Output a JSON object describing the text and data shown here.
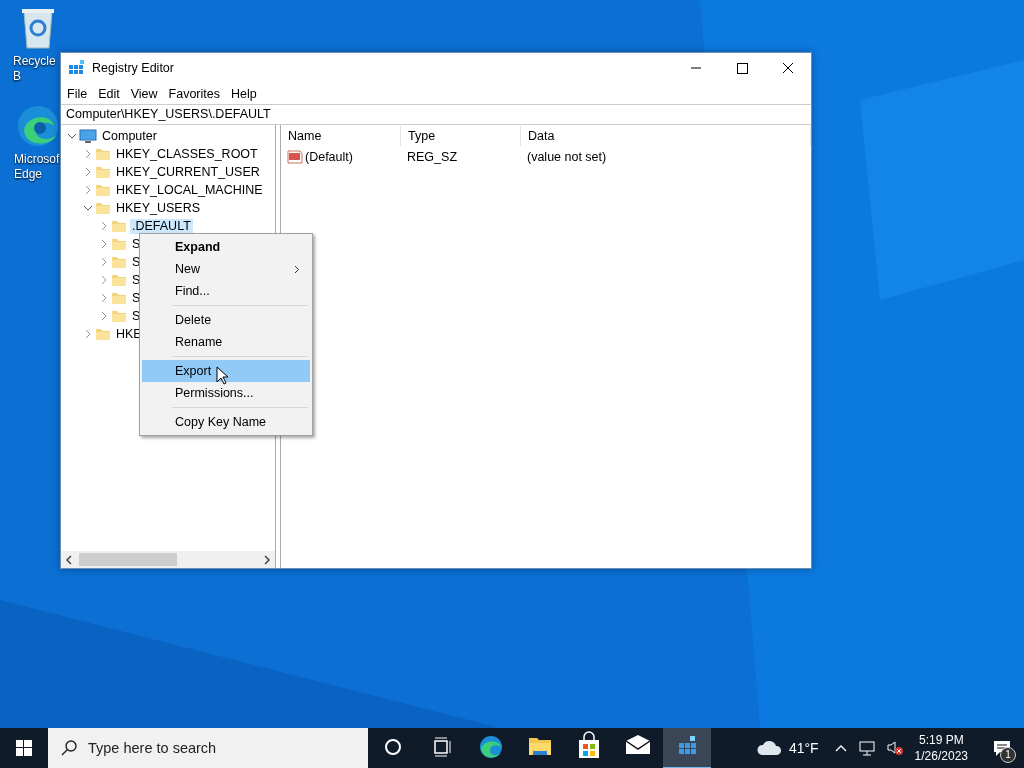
{
  "desktop_icons": [
    {
      "kind": "recycle",
      "label": "Recycle B"
    },
    {
      "kind": "edge",
      "label": "Microsof Edge"
    }
  ],
  "window": {
    "title": "Registry Editor",
    "menu": [
      "File",
      "Edit",
      "View",
      "Favorites",
      "Help"
    ],
    "address": "Computer\\HKEY_USERS\\.DEFAULT",
    "tree": [
      {
        "label": "Computer",
        "expanded": true,
        "selected": false,
        "children": [
          {
            "label": "HKEY_CLASSES_ROOT",
            "expanded": false,
            "selected": false
          },
          {
            "label": "HKEY_CURRENT_USER",
            "expanded": false,
            "selected": false
          },
          {
            "label": "HKEY_LOCAL_MACHINE",
            "expanded": false,
            "selected": false
          },
          {
            "label": "HKEY_USERS",
            "expanded": true,
            "selected": false,
            "children": [
              {
                "label": ".DEFAULT",
                "expanded": false,
                "selected": true
              },
              {
                "label": "S",
                "expanded": false,
                "selected": false
              },
              {
                "label": "S",
                "expanded": false,
                "selected": false
              },
              {
                "label": "S",
                "expanded": false,
                "selected": false
              },
              {
                "label": "S",
                "expanded": false,
                "selected": false
              },
              {
                "label": "S",
                "expanded": false,
                "selected": false
              }
            ]
          },
          {
            "label": "HKE",
            "expanded": false,
            "selected": false
          }
        ]
      }
    ],
    "table": {
      "columns": [
        "Name",
        "Type",
        "Data"
      ],
      "rows": [
        {
          "name": "(Default)",
          "type": "REG_SZ",
          "data": "(value not set)"
        }
      ]
    }
  },
  "context_menu": [
    {
      "kind": "item",
      "label": "Expand",
      "default": true,
      "submenu": false,
      "selected": false
    },
    {
      "kind": "item",
      "label": "New",
      "default": false,
      "submenu": true,
      "selected": false
    },
    {
      "kind": "item",
      "label": "Find...",
      "default": false,
      "submenu": false,
      "selected": false
    },
    {
      "kind": "separator"
    },
    {
      "kind": "item",
      "label": "Delete",
      "default": false,
      "submenu": false,
      "selected": false
    },
    {
      "kind": "item",
      "label": "Rename",
      "default": false,
      "submenu": false,
      "selected": false
    },
    {
      "kind": "separator"
    },
    {
      "kind": "item",
      "label": "Export",
      "default": false,
      "submenu": false,
      "selected": true
    },
    {
      "kind": "item",
      "label": "Permissions...",
      "default": false,
      "submenu": false,
      "selected": false
    },
    {
      "kind": "separator"
    },
    {
      "kind": "item",
      "label": "Copy Key Name",
      "default": false,
      "submenu": false,
      "selected": false
    }
  ],
  "taskbar": {
    "search_placeholder": "Type here to search",
    "apps": [
      {
        "kind": "cortana",
        "active": false
      },
      {
        "kind": "taskview",
        "active": false
      },
      {
        "kind": "edge",
        "active": false
      },
      {
        "kind": "explorer",
        "active": false
      },
      {
        "kind": "store",
        "active": false
      },
      {
        "kind": "mail",
        "active": false
      },
      {
        "kind": "regedit",
        "active": true
      }
    ],
    "temperature": "41°F",
    "time": "5:19 PM",
    "date": "1/26/2023",
    "notification_count": "1"
  }
}
